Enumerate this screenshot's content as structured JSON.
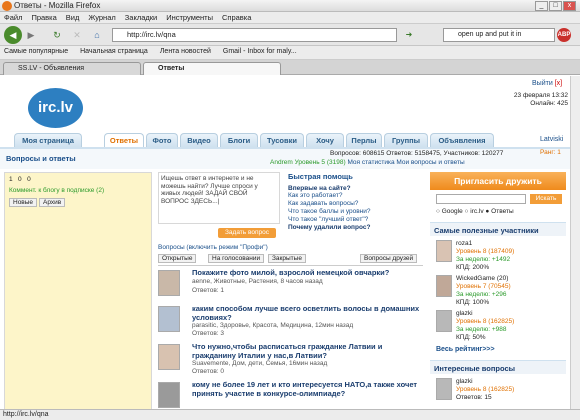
{
  "window": {
    "title": "Ответы - Mozilla Firefox",
    "min": "_",
    "max": "□",
    "close": "x"
  },
  "menu": [
    "Файл",
    "Правка",
    "Вид",
    "Журнал",
    "Закладки",
    "Инструменты",
    "Справка"
  ],
  "nav": {
    "url": "http://irc.lv/qna",
    "search_text": "open up and put it in"
  },
  "bookmarks": [
    "Самые популярные",
    "Начальная страница",
    "Лента новостей",
    "Gmail - Inbox for maly..."
  ],
  "browser_tabs": [
    "SS.LV - Объявления",
    "Ответы"
  ],
  "site": {
    "logo": "irc.lv",
    "exit": "Выйти",
    "exit_x": "[x]",
    "date": "23 февраля 13:32",
    "online": "Онлайн: 425",
    "nav_tabs": [
      "Моя страница",
      "Ответы",
      "Фото",
      "Видео",
      "Блоги",
      "Тусовки",
      "Хочу",
      "Перлы",
      "Группы",
      "Объявления"
    ],
    "lang": "Latviski",
    "section_title": "Вопросы и ответы",
    "stats": "Вопросов: 608615  Ответов: 5158475, Участников: 120277",
    "rank": "Ранг: 1",
    "user_line": "Andrem Уровень 5 (3198)",
    "my_stats": "Моя статистика",
    "my_qa": "Мои вопросы и ответы"
  },
  "left_panel": {
    "counts": [
      "1",
      "0",
      "0"
    ],
    "blog_comments": "Коммент. к блогу в подписке (2)",
    "tab_new": "Новые",
    "tab_archive": "Архив"
  },
  "ask": {
    "placeholder": "Ищешь ответ в интернете и не можешь найти? Лучше спроси у живых людей! ЗАДАЙ СВОЙ ВОПРОС ЗДЕСЬ...|",
    "button": "Задать вопрос"
  },
  "help": {
    "title": "Быстрая помощь",
    "first_time": "Впервые на сайте?",
    "links": [
      "Как это работает?",
      "Как задавать вопросы?",
      "Что такое баллы и уровни?",
      "Что такое \"лучший ответ\"?",
      "Почему удалили вопрос?"
    ]
  },
  "filter": {
    "label": "Вопросы (включить режим \"Профи\")",
    "tabs": [
      "Открытые",
      "На голосовании",
      "Закрытые",
      "Вопросы друзей"
    ]
  },
  "questions": [
    {
      "title": "Покажите фото милой, взрослой немецкой овчарки?",
      "meta": "aenne, Животные, Растения, 8 часов назад",
      "answers": "Ответов: 1"
    },
    {
      "title": "каким способом лучше всего осветлить волосы в домашних условиях?",
      "meta": "parasitic, Здоровье, Красота, Медицина, 12мин назад",
      "answers": "Ответов: 3"
    },
    {
      "title": "Что нужно,чтобы расписаться гражданке Латвии и гражданину Италии у нас,в Латвии?",
      "meta": "Suavemente, Дом, дети, Семья, 16мин назад",
      "answers": "Ответов: 0"
    },
    {
      "title": "кому не более 19 лет и кто интересуется НАТО,а также хочет принять участие в конкурсе-олимпиаде?",
      "meta": "",
      "answers": ""
    }
  ],
  "right": {
    "invite": "Пригласить дружить",
    "search_btn": "Искать",
    "radio": [
      "Google",
      "irc.lv",
      "Ответы"
    ],
    "top_title": "Самые полезные участники",
    "users": [
      {
        "name": "roza1",
        "level": "Уровень 8 (187409)",
        "week": "За неделю: +1492",
        "kpd": "КПД: 200%"
      },
      {
        "name": "WickedGame (20)",
        "level": "Уровень 7 (70545)",
        "week": "За неделю: +296",
        "kpd": "КПД: 100%"
      },
      {
        "name": "glazki",
        "level": "Уровень 8 (162825)",
        "week": "За неделю: +988",
        "kpd": "КПД: 50%"
      }
    ],
    "all_rating": "Весь рейтинг>>>",
    "interesting": "Интересные вопросы",
    "int_user": {
      "name": "glazki",
      "level": "Уровень 8 (162825)",
      "answers": "Ответов: 15"
    }
  },
  "status": "http://irc.lv/qna"
}
